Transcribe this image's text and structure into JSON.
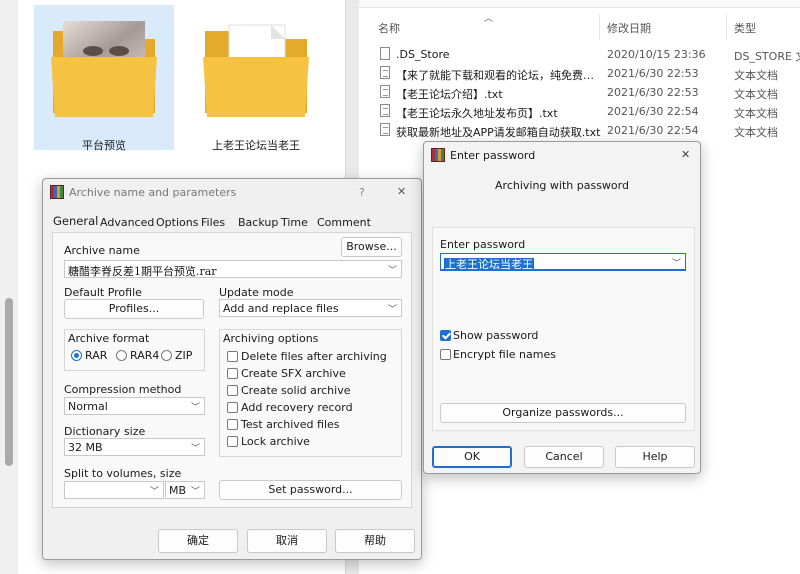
{
  "explorer": {
    "folders": [
      {
        "label": "平台预览",
        "selected": true
      },
      {
        "label": "上老王论坛当老王",
        "selected": false
      }
    ],
    "columns": {
      "name": "名称",
      "modified": "修改日期",
      "type": "类型"
    },
    "files": [
      {
        "name": ".DS_Store",
        "modified": "2020/10/15 23:36",
        "type": "DS_STORE 文",
        "icon": "file-icon"
      },
      {
        "name": "【来了就能下载和观看的论坛，纯免费！…",
        "modified": "2021/6/30 22:53",
        "type": "文本文档",
        "icon": "text-document-icon"
      },
      {
        "name": "【老王论坛介绍】.txt",
        "modified": "2021/6/30 22:53",
        "type": "文本文档",
        "icon": "text-document-icon"
      },
      {
        "name": "【老王论坛永久地址发布页】.txt",
        "modified": "2021/6/30 22:54",
        "type": "文本文档",
        "icon": "text-document-icon"
      },
      {
        "name": "获取最新地址及APP请发邮箱自动获取.txt",
        "modified": "2021/6/30 22:54",
        "type": "文本文档",
        "icon": "text-document-icon"
      }
    ]
  },
  "archive_dialog": {
    "title": "Archive name and parameters",
    "help_glyph": "?",
    "close_glyph": "✕",
    "tabs": [
      "General",
      "Advanced",
      "Options",
      "Files",
      "Backup",
      "Time",
      "Comment"
    ],
    "archive_name_label": "Archive name",
    "browse_label": "Browse...",
    "archive_name_value": "糖醋李脊反差1期平台预览.rar",
    "default_profile_label": "Default Profile",
    "profiles_label": "Profiles...",
    "update_mode_label": "Update mode",
    "update_mode_value": "Add and replace files",
    "archive_format_label": "Archive format",
    "formats": [
      {
        "label": "RAR",
        "checked": true
      },
      {
        "label": "RAR4",
        "checked": false
      },
      {
        "label": "ZIP",
        "checked": false
      }
    ],
    "archiving_options_label": "Archiving options",
    "options": [
      {
        "label": "Delete files after archiving",
        "checked": false
      },
      {
        "label": "Create SFX archive",
        "checked": false
      },
      {
        "label": "Create solid archive",
        "checked": false
      },
      {
        "label": "Add recovery record",
        "checked": false
      },
      {
        "label": "Test archived files",
        "checked": false
      },
      {
        "label": "Lock archive",
        "checked": false
      }
    ],
    "compression_label": "Compression method",
    "compression_value": "Normal",
    "dictionary_label": "Dictionary size",
    "dictionary_value": "32 MB",
    "split_label": "Split to volumes, size",
    "split_value": "",
    "split_unit": "MB",
    "set_password_label": "Set password...",
    "ok_label": "确定",
    "cancel_label": "取消",
    "help_label": "帮助"
  },
  "password_dialog": {
    "title": "Enter password",
    "close_glyph": "✕",
    "subtitle": "Archiving with password",
    "enter_password_label": "Enter password",
    "password_value": "上老王论坛当老王",
    "show_password_label": "Show password",
    "show_password_checked": true,
    "encrypt_names_label": "Encrypt file names",
    "encrypt_names_checked": false,
    "organize_label": "Organize passwords...",
    "ok_label": "OK",
    "cancel_label": "Cancel",
    "help_label": "Help"
  },
  "colors": {
    "accent": "#1d6fd1",
    "selection": "#d9ebfb",
    "folder": "#f5c242"
  }
}
